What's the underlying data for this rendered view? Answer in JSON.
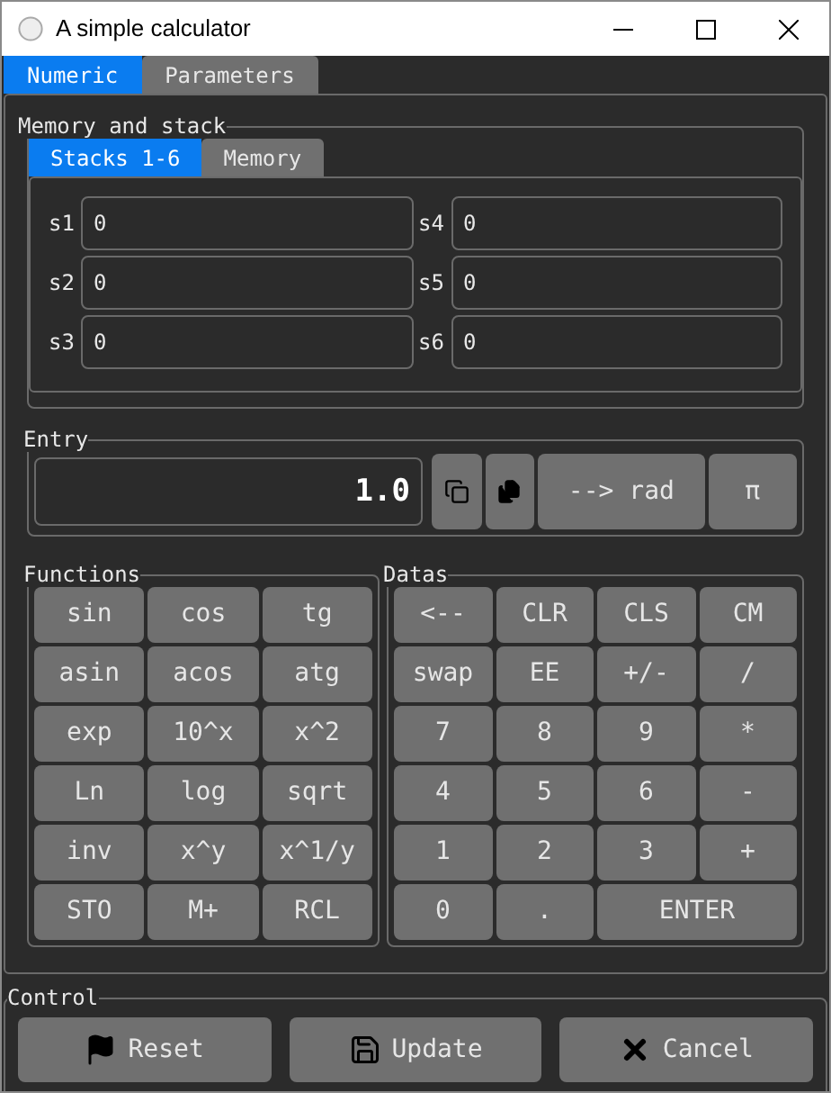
{
  "window": {
    "title": "A simple calculator"
  },
  "tabs": [
    {
      "label": "Numeric",
      "selected": true
    },
    {
      "label": "Parameters",
      "selected": false
    }
  ],
  "memory_and_stack": {
    "title": "Memory and stack",
    "tabs": [
      {
        "label": "Stacks 1-6",
        "selected": true
      },
      {
        "label": "Memory",
        "selected": false
      }
    ],
    "fields": [
      {
        "label": "s1",
        "value": "0"
      },
      {
        "label": "s4",
        "value": "0"
      },
      {
        "label": "s2",
        "value": "0"
      },
      {
        "label": "s5",
        "value": "0"
      },
      {
        "label": "s3",
        "value": "0"
      },
      {
        "label": "s6",
        "value": "0"
      }
    ]
  },
  "entry": {
    "title": "Entry",
    "value": "1.0",
    "buttons": [
      {
        "kind": "copy"
      },
      {
        "kind": "paste"
      },
      {
        "kind": "text",
        "label": "--> rad"
      },
      {
        "kind": "text",
        "label": "π"
      }
    ]
  },
  "functions": {
    "title": "Functions",
    "keys": [
      "sin",
      "cos",
      "tg",
      "asin",
      "acos",
      "atg",
      "exp",
      "10^x",
      "x^2",
      "Ln",
      "log",
      "sqrt",
      "inv",
      "x^y",
      "x^1/y",
      "STO",
      "M+",
      "RCL"
    ]
  },
  "datas": {
    "title": "Datas",
    "keys": [
      {
        "label": "<--",
        "kind": "key"
      },
      {
        "label": "CLR",
        "kind": "key"
      },
      {
        "label": "CLS",
        "kind": "key"
      },
      {
        "label": "CM",
        "kind": "key"
      },
      {
        "label": "swap",
        "kind": "key"
      },
      {
        "label": "EE",
        "kind": "key"
      },
      {
        "label": "+/-",
        "kind": "key"
      },
      {
        "label": "/",
        "kind": "key"
      },
      {
        "label": "7",
        "kind": "key"
      },
      {
        "label": "8",
        "kind": "key"
      },
      {
        "label": "9",
        "kind": "key"
      },
      {
        "label": "*",
        "kind": "key"
      },
      {
        "label": "4",
        "kind": "key"
      },
      {
        "label": "5",
        "kind": "key"
      },
      {
        "label": "6",
        "kind": "key"
      },
      {
        "label": "-",
        "kind": "key"
      },
      {
        "label": "1",
        "kind": "key"
      },
      {
        "label": "2",
        "kind": "key"
      },
      {
        "label": "3",
        "kind": "key"
      },
      {
        "label": "+",
        "kind": "key"
      },
      {
        "label": "0",
        "kind": "key"
      },
      {
        "label": ".",
        "kind": "key"
      },
      {
        "label": "ENTER",
        "kind": "wide"
      }
    ]
  },
  "control": {
    "title": "Control",
    "buttons": [
      {
        "label": "Reset",
        "kind": "flag"
      },
      {
        "label": "Update",
        "kind": "save"
      },
      {
        "label": "Cancel",
        "kind": "cancel"
      }
    ]
  }
}
